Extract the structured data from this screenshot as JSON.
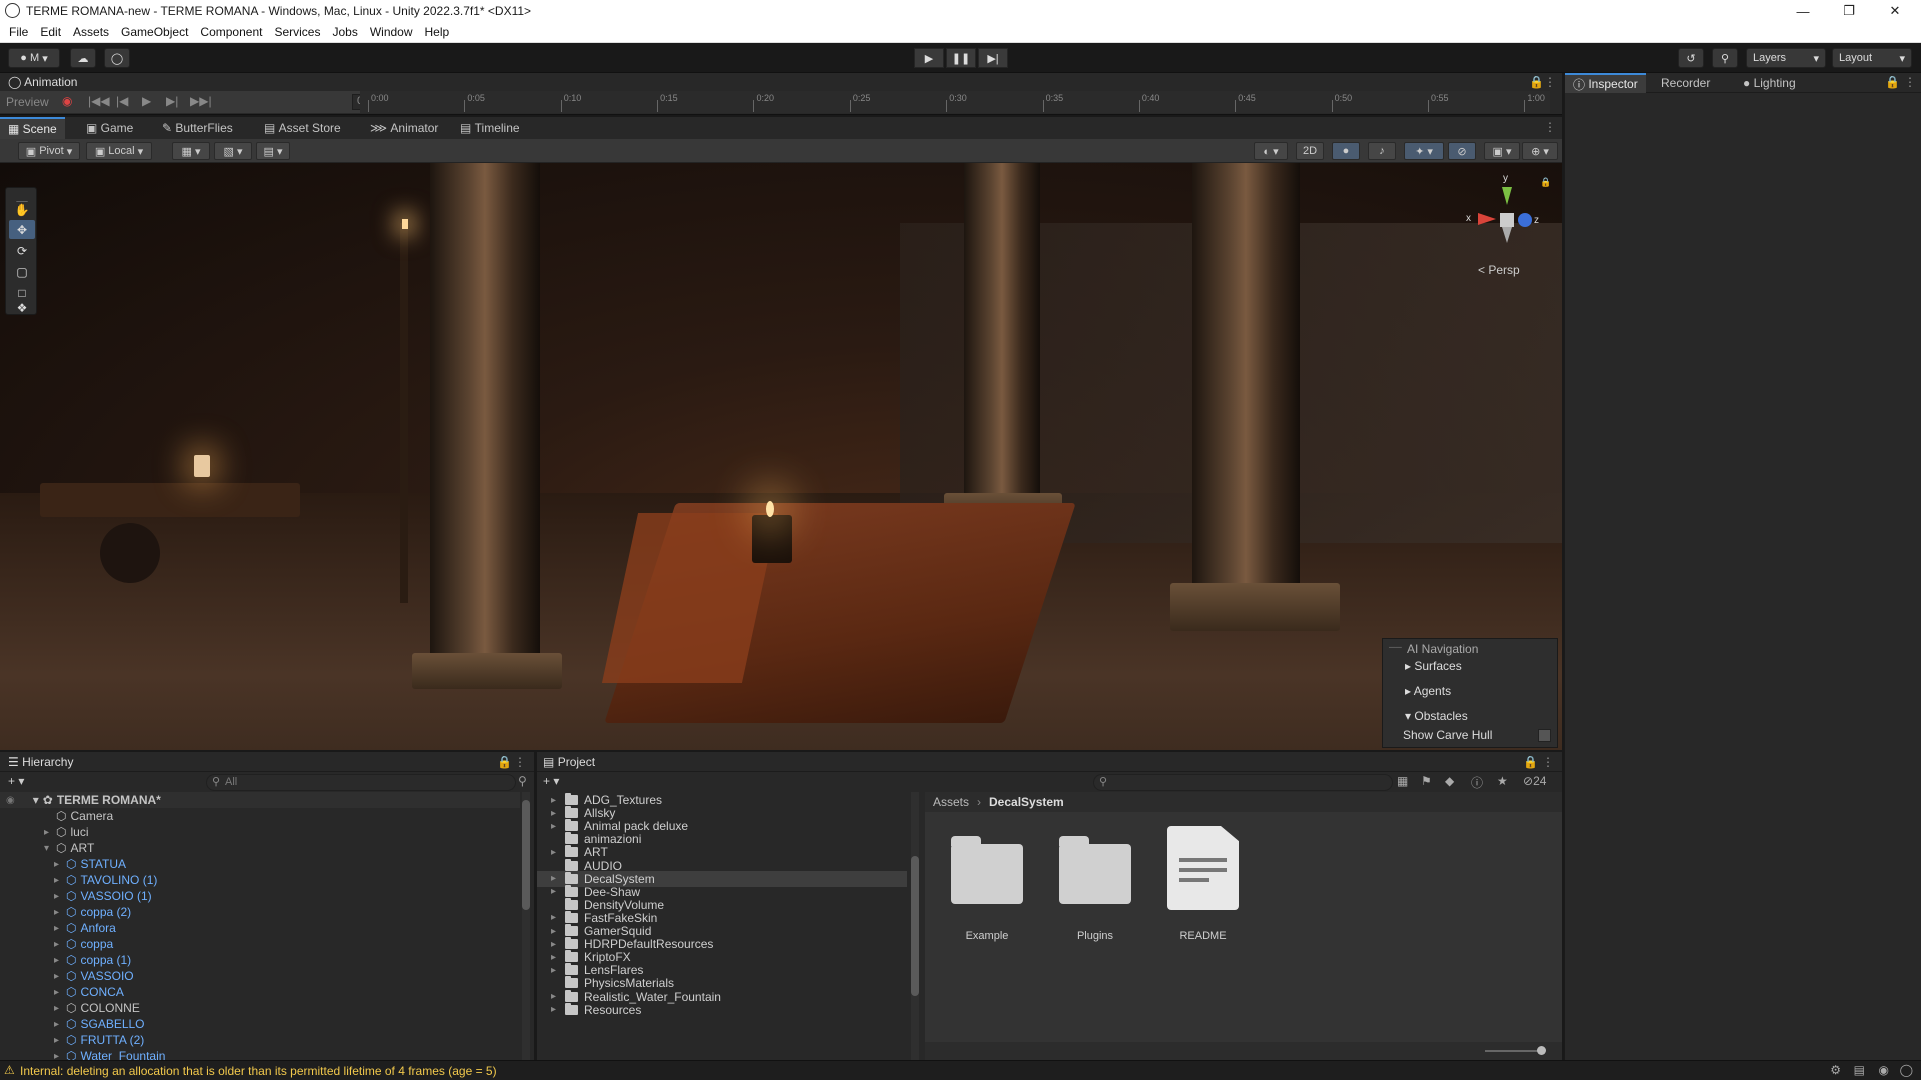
{
  "window": {
    "title": "TERME ROMANA-new - TERME ROMANA - Windows, Mac, Linux - Unity 2022.3.7f1* <DX11>"
  },
  "menu": [
    "File",
    "Edit",
    "Assets",
    "GameObject",
    "Component",
    "Services",
    "Jobs",
    "Window",
    "Help"
  ],
  "toolbar": {
    "account": "M",
    "layers": "Layers",
    "layout": "Layout"
  },
  "animation": {
    "tab": "Animation",
    "preview": "Preview",
    "frame": "0",
    "ticks": [
      "0:00",
      "0:05",
      "0:10",
      "0:15",
      "0:20",
      "0:25",
      "0:30",
      "0:35",
      "0:40",
      "0:45",
      "0:50",
      "0:55",
      "1:00"
    ]
  },
  "scene_tabs": [
    "Scene",
    "Game",
    "ButterFlies",
    "Asset Store",
    "Animator",
    "Timeline"
  ],
  "scene_tools": {
    "pivot": "Pivot",
    "local": "Local",
    "two_d": "2D",
    "persp": "Persp",
    "gizmo_x": "x",
    "gizmo_y": "y",
    "gizmo_z": "z"
  },
  "ai_navigation": {
    "title": "AI Navigation",
    "items": [
      "Surfaces",
      "Agents",
      "Obstacles",
      "Show Carve Hull"
    ]
  },
  "hierarchy": {
    "title": "Hierarchy",
    "search_placeholder": "All",
    "scene": "TERME ROMANA*",
    "items": [
      {
        "label": "Camera",
        "depth": 1,
        "prefab": false
      },
      {
        "label": "luci",
        "depth": 1,
        "prefab": false
      },
      {
        "label": "ART",
        "depth": 1,
        "prefab": false
      },
      {
        "label": "STATUA",
        "depth": 2,
        "prefab": true
      },
      {
        "label": "TAVOLINO (1)",
        "depth": 2,
        "prefab": true
      },
      {
        "label": "VASSOIO (1)",
        "depth": 2,
        "prefab": true
      },
      {
        "label": "coppa (2)",
        "depth": 2,
        "prefab": true
      },
      {
        "label": "Anfora",
        "depth": 2,
        "prefab": true
      },
      {
        "label": "coppa",
        "depth": 2,
        "prefab": true
      },
      {
        "label": "coppa (1)",
        "depth": 2,
        "prefab": true
      },
      {
        "label": "VASSOIO",
        "depth": 2,
        "prefab": true
      },
      {
        "label": "CONCA",
        "depth": 2,
        "prefab": true
      },
      {
        "label": "COLONNE",
        "depth": 2,
        "prefab": false
      },
      {
        "label": "SGABELLO",
        "depth": 2,
        "prefab": true
      },
      {
        "label": "FRUTTA (2)",
        "depth": 2,
        "prefab": true
      },
      {
        "label": "Water_Fountain",
        "depth": 2,
        "prefab": true
      }
    ]
  },
  "project": {
    "title": "Project",
    "hidden_count": "24",
    "folders": [
      "ADG_Textures",
      "Allsky",
      "Animal pack deluxe",
      "animazioni",
      "ART",
      "AUDIO",
      "DecalSystem",
      "Dee-Shaw",
      "DensityVolume",
      "FastFakeSkin",
      "GamerSquid",
      "HDRPDefaultResources",
      "KriptoFX",
      "LensFlares",
      "PhysicsMaterials",
      "Realistic_Water_Fountain",
      "Resources"
    ],
    "selected": "DecalSystem",
    "breadcrumb": [
      "Assets",
      "DecalSystem"
    ],
    "assets": [
      "Example",
      "Plugins",
      "README"
    ]
  },
  "inspector_tabs": [
    "Inspector",
    "Recorder",
    "Lighting"
  ],
  "status": {
    "message": "Internal: deleting an allocation that is older than its permitted lifetime of 4 frames (age = 5)"
  },
  "colors": {
    "accent": "#3d8ad9",
    "prefab": "#6fb0ff",
    "warning": "#f2c94c"
  }
}
